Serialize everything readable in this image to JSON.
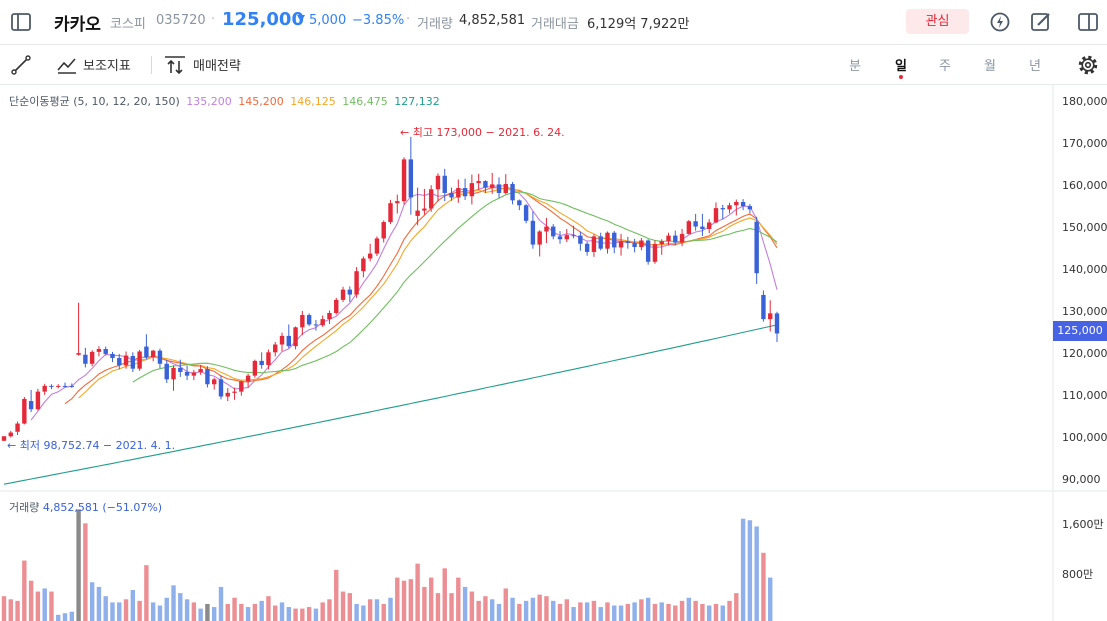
{
  "header": {
    "name": "카카오",
    "market": "코스피",
    "code": "035720",
    "price": "125,000",
    "change": "5,000",
    "change_pct": "−3.85%",
    "volume_label": "거래량",
    "volume": "4,852,581",
    "amount_label": "거래대금",
    "amount": "6,129억 7,922만",
    "favorite_label": "관심"
  },
  "toolbar": {
    "indicators_label": "보조지표",
    "strategy_label": "매매전략",
    "periods": [
      "분",
      "일",
      "주",
      "월",
      "년"
    ],
    "active_period": "일"
  },
  "legend": {
    "title": "단순이동평균 (5, 10, 12, 20, 150)",
    "ma_values": [
      {
        "value": "135,200",
        "color": "#c47fe0"
      },
      {
        "value": "145,200",
        "color": "#f16a3b"
      },
      {
        "value": "146,125",
        "color": "#f5a623"
      },
      {
        "value": "146,475",
        "color": "#6fbf5f"
      },
      {
        "value": "127,132",
        "color": "#1f9e8a"
      }
    ]
  },
  "annotations": {
    "high": "최고 173,000 − 2021. 6. 24.",
    "low": "최저 98,752.74 − 2021. 4. 1."
  },
  "price_axis": [
    "180,000",
    "170,000",
    "160,000",
    "150,000",
    "140,000",
    "130,000",
    "120,000",
    "110,000",
    "100,000",
    "90,000"
  ],
  "current_price_tag": "125,000",
  "volume_panel": {
    "label": "거래량",
    "value": "4,852,581 (−51.07%)",
    "axis": [
      "1,600만",
      "800만"
    ]
  },
  "colors": {
    "up": "#e42939",
    "down": "#3a62d8",
    "accent": "#3182f6"
  },
  "chart_data": {
    "type": "candlestick",
    "ylim": [
      88000,
      182000
    ],
    "candles": [
      [
        98800,
        99900,
        98700,
        99900
      ],
      [
        99900,
        101200,
        99600,
        100800
      ],
      [
        101000,
        103500,
        100200,
        103000
      ],
      [
        103000,
        109500,
        102800,
        109000
      ],
      [
        108500,
        111200,
        105800,
        106500
      ],
      [
        106500,
        111500,
        106200,
        110800
      ],
      [
        110800,
        112700,
        110000,
        112200
      ],
      [
        112200,
        112600,
        111400,
        112100
      ],
      [
        112100,
        112600,
        111600,
        112200
      ],
      [
        112200,
        113000,
        111800,
        112000
      ],
      [
        112200,
        112800,
        111700,
        112100
      ],
      [
        119800,
        132500,
        119600,
        120200
      ],
      [
        119800,
        121500,
        116700,
        117600
      ],
      [
        117600,
        120900,
        117000,
        120500
      ],
      [
        120500,
        121900,
        119400,
        121200
      ],
      [
        121200,
        121800,
        119600,
        120000
      ],
      [
        120000,
        120500,
        118000,
        119000
      ],
      [
        119000,
        120000,
        116200,
        117200
      ],
      [
        117200,
        120600,
        116400,
        119600
      ],
      [
        119500,
        120400,
        115600,
        116400
      ],
      [
        116400,
        121000,
        115900,
        120600
      ],
      [
        121800,
        124800,
        118700,
        119200
      ],
      [
        119200,
        121000,
        118200,
        120800
      ],
      [
        120800,
        121300,
        116500,
        117600
      ],
      [
        117600,
        118600,
        112900,
        113800
      ],
      [
        113800,
        117200,
        111000,
        116600
      ],
      [
        116600,
        118600,
        114400,
        115600
      ],
      [
        115600,
        117100,
        113600,
        114700
      ],
      [
        114700,
        116100,
        113600,
        115500
      ],
      [
        115500,
        117300,
        114900,
        116300
      ],
      [
        116300,
        117000,
        111800,
        112600
      ],
      [
        112600,
        114200,
        111300,
        113800
      ],
      [
        113800,
        114800,
        108900,
        109600
      ],
      [
        109600,
        111700,
        108500,
        110500
      ],
      [
        110500,
        111800,
        108800,
        110800
      ],
      [
        110800,
        113500,
        109800,
        113300
      ],
      [
        113300,
        115200,
        111800,
        114700
      ],
      [
        114700,
        118600,
        114200,
        118300
      ],
      [
        118300,
        120400,
        116400,
        117300
      ],
      [
        117300,
        121100,
        116200,
        120400
      ],
      [
        120400,
        122900,
        119400,
        122300
      ],
      [
        122300,
        125200,
        120700,
        124400
      ],
      [
        124400,
        127200,
        121400,
        121900
      ],
      [
        121900,
        126700,
        121100,
        126500
      ],
      [
        126500,
        130500,
        124600,
        129500
      ],
      [
        129500,
        129900,
        126800,
        127200
      ],
      [
        127200,
        128300,
        125700,
        127000
      ],
      [
        127000,
        129400,
        126600,
        128500
      ],
      [
        128500,
        130600,
        127300,
        130000
      ],
      [
        130000,
        133700,
        129600,
        133200
      ],
      [
        133200,
        136400,
        132700,
        135700
      ],
      [
        135700,
        136500,
        132700,
        134500
      ],
      [
        134500,
        141200,
        133700,
        140200
      ],
      [
        140200,
        143800,
        138700,
        143300
      ],
      [
        143300,
        146900,
        142600,
        144500
      ],
      [
        144500,
        148700,
        143900,
        148200
      ],
      [
        148200,
        152600,
        147200,
        152200
      ],
      [
        152200,
        157600,
        151700,
        156800
      ],
      [
        156800,
        158900,
        154300,
        157300
      ],
      [
        157300,
        168000,
        156500,
        167500
      ],
      [
        167500,
        173000,
        154000,
        158200
      ],
      [
        153700,
        160600,
        151400,
        155000
      ],
      [
        155000,
        160300,
        154000,
        155500
      ],
      [
        155500,
        161200,
        154700,
        160200
      ],
      [
        160200,
        164100,
        157200,
        163500
      ],
      [
        163500,
        165200,
        157300,
        159300
      ],
      [
        159300,
        160600,
        157400,
        158200
      ],
      [
        158200,
        162600,
        156900,
        160500
      ],
      [
        160500,
        162800,
        157600,
        158500
      ],
      [
        158500,
        163800,
        156500,
        161700
      ],
      [
        161700,
        164000,
        160000,
        162200
      ],
      [
        162200,
        162400,
        159300,
        160600
      ],
      [
        160600,
        164200,
        159100,
        161400
      ],
      [
        161400,
        163100,
        158100,
        159300
      ],
      [
        159300,
        163900,
        159000,
        161500
      ],
      [
        161500,
        162000,
        156500,
        157500
      ],
      [
        157500,
        157700,
        155100,
        156300
      ],
      [
        156300,
        156600,
        151900,
        152500
      ],
      [
        152500,
        154800,
        145700,
        146700
      ],
      [
        146700,
        150200,
        143800,
        149900
      ],
      [
        149900,
        153200,
        147100,
        151100
      ],
      [
        151100,
        151700,
        148000,
        148700
      ],
      [
        148700,
        150000,
        146900,
        148000
      ],
      [
        148000,
        150500,
        147300,
        149000
      ],
      [
        149000,
        151300,
        148200,
        148900
      ],
      [
        148900,
        149900,
        145200,
        146900
      ],
      [
        146900,
        147400,
        144000,
        144900
      ],
      [
        144900,
        149200,
        143700,
        148700
      ],
      [
        148700,
        149600,
        145300,
        145700
      ],
      [
        145700,
        149900,
        144500,
        149600
      ],
      [
        149600,
        150000,
        144600,
        146000
      ],
      [
        146000,
        149300,
        144000,
        147500
      ],
      [
        147500,
        148600,
        145700,
        147100
      ],
      [
        147100,
        148100,
        144800,
        146100
      ],
      [
        146100,
        148300,
        145300,
        147700
      ],
      [
        147700,
        148000,
        141800,
        142500
      ],
      [
        142500,
        147700,
        142000,
        146800
      ],
      [
        146800,
        148000,
        144200,
        147500
      ],
      [
        147500,
        149600,
        146500,
        148900
      ],
      [
        148900,
        150100,
        146500,
        147200
      ],
      [
        147200,
        150500,
        146300,
        149300
      ],
      [
        149300,
        152700,
        149200,
        152400
      ],
      [
        152400,
        154200,
        150100,
        151100
      ],
      [
        151100,
        154200,
        148800,
        150500
      ],
      [
        150500,
        152900,
        149500,
        152100
      ],
      [
        152100,
        157000,
        151900,
        155600
      ],
      [
        155600,
        156400,
        152900,
        155300
      ],
      [
        155300,
        156900,
        154300,
        156300
      ],
      [
        156300,
        157700,
        153800,
        157100
      ],
      [
        157100,
        157800,
        155100,
        156100
      ],
      [
        156100,
        156600,
        154400,
        155300
      ],
      [
        152300,
        153500,
        137100,
        139700
      ],
      [
        134400,
        135500,
        127900,
        128500
      ],
      [
        128500,
        133100,
        125500,
        129900
      ],
      [
        129900,
        130300,
        122900,
        125000
      ]
    ],
    "volumes": [
      [
        160,
        "up"
      ],
      [
        140,
        "up"
      ],
      [
        130,
        "up"
      ],
      [
        390,
        "up"
      ],
      [
        260,
        "up"
      ],
      [
        190,
        "up"
      ],
      [
        210,
        "down"
      ],
      [
        190,
        "up"
      ],
      [
        40,
        "down"
      ],
      [
        50,
        "down"
      ],
      [
        60,
        "down"
      ],
      [
        720,
        "flat"
      ],
      [
        630,
        "up"
      ],
      [
        250,
        "down"
      ],
      [
        220,
        "down"
      ],
      [
        160,
        "down"
      ],
      [
        120,
        "down"
      ],
      [
        120,
        "down"
      ],
      [
        140,
        "up"
      ],
      [
        200,
        "down"
      ],
      [
        130,
        "up"
      ],
      [
        360,
        "up"
      ],
      [
        120,
        "down"
      ],
      [
        100,
        "down"
      ],
      [
        150,
        "down"
      ],
      [
        230,
        "down"
      ],
      [
        180,
        "down"
      ],
      [
        140,
        "down"
      ],
      [
        120,
        "up"
      ],
      [
        80,
        "down"
      ],
      [
        110,
        "flat"
      ],
      [
        90,
        "down"
      ],
      [
        220,
        "down"
      ],
      [
        110,
        "up"
      ],
      [
        150,
        "up"
      ],
      [
        110,
        "up"
      ],
      [
        90,
        "down"
      ],
      [
        110,
        "up"
      ],
      [
        130,
        "down"
      ],
      [
        160,
        "up"
      ],
      [
        100,
        "up"
      ],
      [
        120,
        "down"
      ],
      [
        90,
        "down"
      ],
      [
        80,
        "up"
      ],
      [
        80,
        "up"
      ],
      [
        90,
        "up"
      ],
      [
        80,
        "down"
      ],
      [
        120,
        "up"
      ],
      [
        140,
        "up"
      ],
      [
        330,
        "up"
      ],
      [
        190,
        "up"
      ],
      [
        180,
        "up"
      ],
      [
        110,
        "down"
      ],
      [
        100,
        "down"
      ],
      [
        140,
        "up"
      ],
      [
        140,
        "down"
      ],
      [
        110,
        "up"
      ],
      [
        150,
        "down"
      ],
      [
        280,
        "up"
      ],
      [
        260,
        "up"
      ],
      [
        270,
        "up"
      ],
      [
        370,
        "up"
      ],
      [
        220,
        "up"
      ],
      [
        280,
        "up"
      ],
      [
        180,
        "up"
      ],
      [
        340,
        "up"
      ],
      [
        180,
        "up"
      ],
      [
        280,
        "up"
      ],
      [
        220,
        "down"
      ],
      [
        190,
        "up"
      ],
      [
        130,
        "up"
      ],
      [
        160,
        "up"
      ],
      [
        140,
        "down"
      ],
      [
        110,
        "down"
      ],
      [
        210,
        "up"
      ],
      [
        150,
        "down"
      ],
      [
        110,
        "up"
      ],
      [
        130,
        "down"
      ],
      [
        150,
        "down"
      ],
      [
        170,
        "up"
      ],
      [
        160,
        "up"
      ],
      [
        130,
        "down"
      ],
      [
        110,
        "up"
      ],
      [
        140,
        "up"
      ],
      [
        90,
        "down"
      ],
      [
        120,
        "up"
      ],
      [
        120,
        "down"
      ],
      [
        130,
        "up"
      ],
      [
        90,
        "down"
      ],
      [
        120,
        "up"
      ],
      [
        100,
        "down"
      ],
      [
        100,
        "down"
      ],
      [
        110,
        "up"
      ],
      [
        120,
        "down"
      ],
      [
        140,
        "up"
      ],
      [
        150,
        "down"
      ],
      [
        110,
        "up"
      ],
      [
        120,
        "down"
      ],
      [
        110,
        "up"
      ],
      [
        100,
        "up"
      ],
      [
        130,
        "up"
      ],
      [
        150,
        "down"
      ],
      [
        130,
        "up"
      ],
      [
        110,
        "up"
      ],
      [
        100,
        "down"
      ],
      [
        110,
        "up"
      ],
      [
        100,
        "down"
      ],
      [
        130,
        "up"
      ],
      [
        180,
        "up"
      ],
      [
        660,
        "down"
      ],
      [
        650,
        "down"
      ],
      [
        610,
        "down"
      ],
      [
        440,
        "up"
      ],
      [
        280,
        "down"
      ]
    ],
    "ma_series": [
      {
        "period": 5,
        "color": "#c47fe0"
      },
      {
        "period": 10,
        "color": "#f16a3b"
      },
      {
        "period": 12,
        "color": "#f5a623"
      },
      {
        "period": 20,
        "color": "#6fbf5f"
      },
      {
        "period": 150,
        "color": "#1f9e8a"
      }
    ]
  }
}
